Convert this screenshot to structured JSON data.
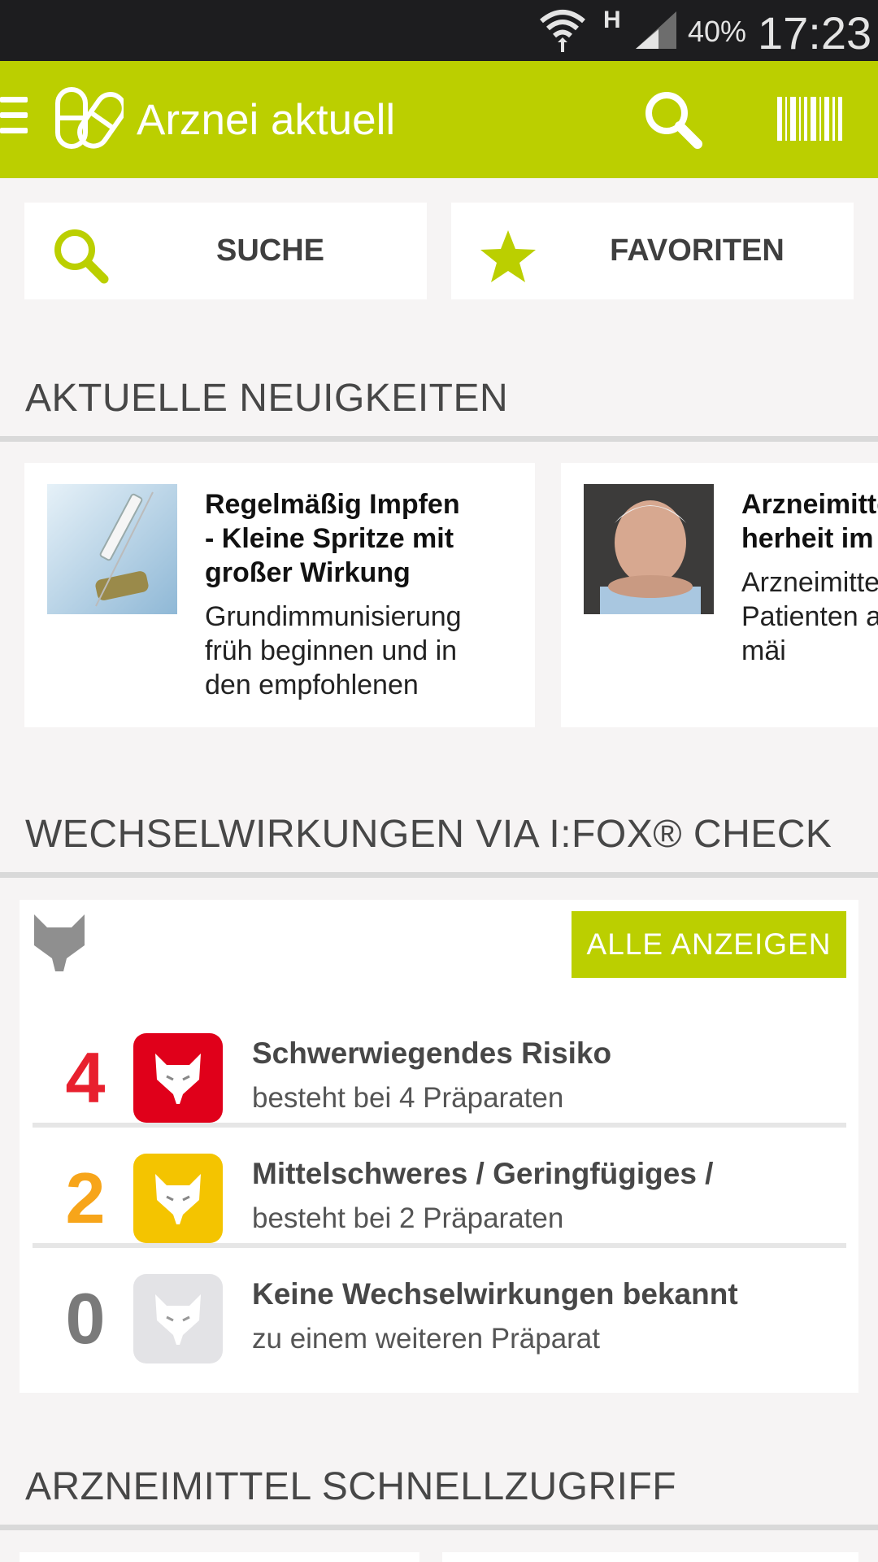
{
  "status_bar": {
    "network": "H",
    "battery": "40%",
    "time": "17:23"
  },
  "app_bar": {
    "title": "Arznei aktuell"
  },
  "quick_buttons": {
    "search_label": "SUCHE",
    "favorites_label": "FAVORITEN"
  },
  "news": {
    "section_title": "AKTUELLE NEUIGKEITEN",
    "items": [
      {
        "headline": "Regelmäßig Impfen - Kleine Spritze mit großer Wirkung",
        "teaser": "Grundimmunisierung früh beginnen und in den empfohlenen"
      },
      {
        "headline": "Arzneimittelsic herheit im",
        "teaser": "Arzneimittel Patienten a oft nur mäi"
      }
    ]
  },
  "interactions": {
    "section_title": "WECHSELWIRKUNGEN VIA I:FOX® CHECK",
    "show_all_label": "ALLE ANZEIGEN",
    "rows": [
      {
        "count": "4",
        "title": "Schwerwiegendes Risiko",
        "subtitle": "besteht bei 4 Präparaten",
        "color": "#e8202e",
        "badge_color": "#e0001a"
      },
      {
        "count": "2",
        "title": "Mittelschweres / Geringfügiges /",
        "subtitle": "besteht bei 2 Präparaten",
        "color": "#f7a51a",
        "badge_color": "#f4c400"
      },
      {
        "count": "0",
        "title": "Keine Wechselwirkungen bekannt",
        "subtitle": "zu einem weiteren Präparat",
        "color": "#7a7a7a",
        "badge_color": "#e3e3e6"
      }
    ]
  },
  "quick_access": {
    "section_title": "ARZNEIMITTEL SCHNELLZUGRIFF"
  },
  "colors": {
    "brand": "#bbcf00",
    "status_bar": "#1d1d1f",
    "background": "#f6f4f4"
  }
}
